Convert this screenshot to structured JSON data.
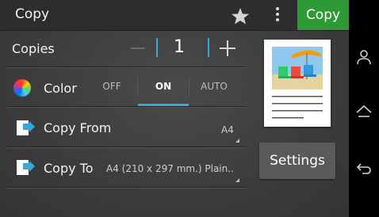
{
  "topbar": {
    "title": "Copy",
    "copy_button": "Copy"
  },
  "copies": {
    "label": "Copies",
    "value": "1"
  },
  "color": {
    "label": "Color",
    "options": [
      "OFF",
      "ON",
      "AUTO"
    ],
    "selected": "ON"
  },
  "copy_from": {
    "label": "Copy From",
    "value": "A4"
  },
  "copy_to": {
    "label": "Copy To",
    "value": "A4 (210 x 297 mm.) Plain.."
  },
  "settings": {
    "label": "Settings"
  },
  "accent_color": "#33a8e0",
  "copy_button_color": "#2e9a35",
  "icons": [
    "star-icon",
    "more-vert-icon",
    "color-wheel-icon",
    "document-arrow-icon",
    "user-icon",
    "home-icon",
    "back-icon"
  ]
}
